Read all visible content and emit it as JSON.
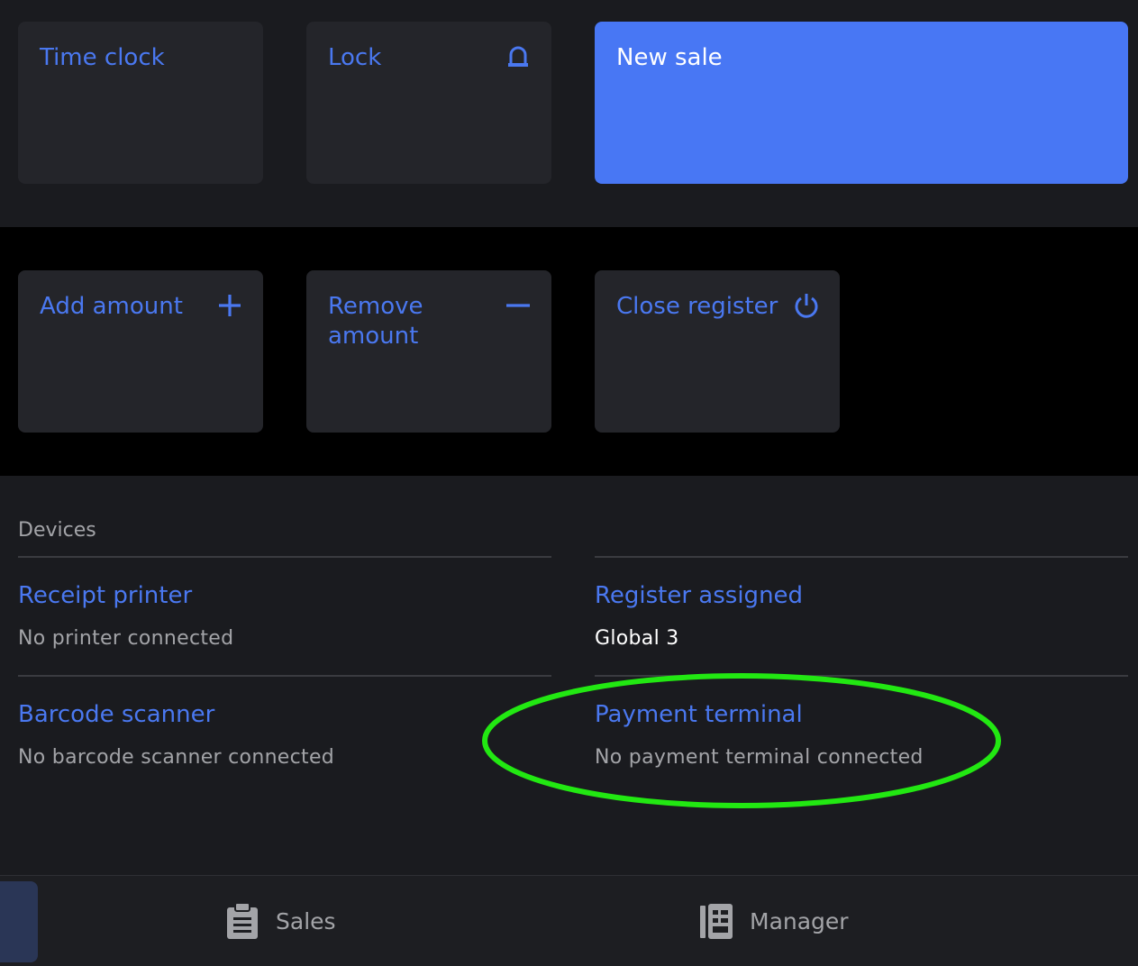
{
  "colors": {
    "accent": "#4a78f0",
    "primary_tile": "#4877f4",
    "tile_bg": "#24252a",
    "highlight": "#22e812"
  },
  "top_tiles": {
    "time_clock": {
      "label": "Time clock"
    },
    "lock": {
      "label": "Lock",
      "icon": "bell-icon"
    },
    "new_sale": {
      "label": "New sale"
    }
  },
  "register_tiles": {
    "add_amount": {
      "label": "Add amount",
      "icon": "plus-icon"
    },
    "remove_amount": {
      "label": "Remove amount",
      "icon": "minus-icon"
    },
    "close_register": {
      "label": "Close register",
      "icon": "power-icon"
    }
  },
  "devices": {
    "heading": "Devices",
    "receipt_printer": {
      "title": "Receipt printer",
      "status": "No printer connected"
    },
    "register_assigned": {
      "title": "Register assigned",
      "value": "Global 3"
    },
    "barcode_scanner": {
      "title": "Barcode scanner",
      "status": "No barcode scanner connected"
    },
    "payment_terminal": {
      "title": "Payment terminal",
      "status": "No payment terminal connected"
    }
  },
  "bottom_nav": {
    "sales": {
      "label": "Sales",
      "icon": "clipboard-icon"
    },
    "manager": {
      "label": "Manager",
      "icon": "ledger-icon"
    }
  }
}
